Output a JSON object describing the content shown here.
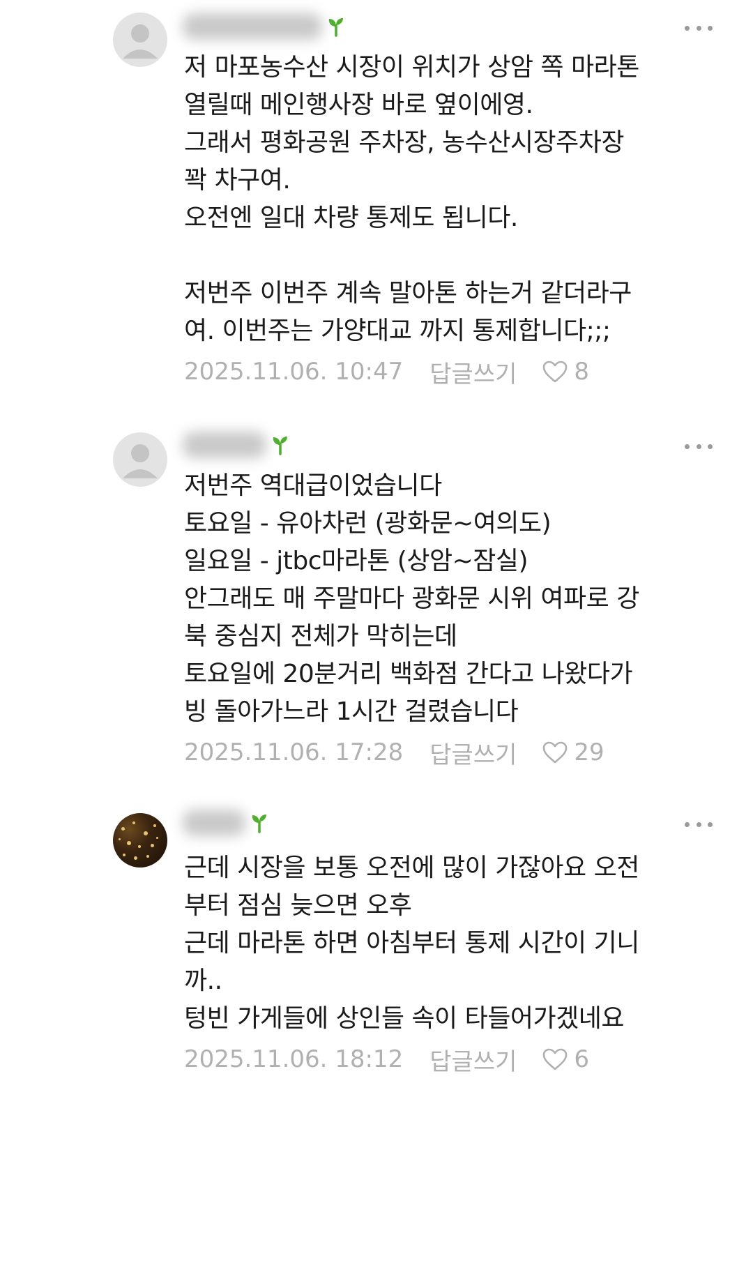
{
  "comments": [
    {
      "avatar": "default-avatar-icon",
      "nickname": "blurred-user-1",
      "body": "저 마포농수산 시장이 위치가 상암 쪽 마라톤\n열릴때 메인행사장 바로 옆이에영.\n그래서 평화공원 주차장, 농수산시장주차장\n꽉 차구여.\n오전엔 일대 차량 통제도 됩니다.\n\n저번주 이번주 계속 말아톤 하는거 같더라구\n여. 이번주는 가양대교 까지 통제합니다;;;",
      "date": "2025.11.06. 10:47",
      "reply_label": "답글쓰기",
      "likes": "8"
    },
    {
      "avatar": "default-avatar-icon",
      "nickname": "blurred-user-2",
      "body": "저번주 역대급이었습니다\n토요일 - 유아차런 (광화문~여의도)\n일요일 - jtbc마라톤 (상암~잠실)\n안그래도 매 주말마다 광화문 시위 여파로 강\n북 중심지 전체가 막히는데\n토요일에 20분거리 백화점 간다고 나왔다가\n빙 돌아가느라 1시간 걸렸습니다",
      "date": "2025.11.06. 17:28",
      "reply_label": "답글쓰기",
      "likes": "29"
    },
    {
      "avatar": "photo-avatar",
      "nickname": "blurred-user-3",
      "body": "근데 시장을 보통 오전에 많이 가잖아요 오전\n부터 점심 늦으면 오후\n근데 마라톤 하면 아침부터 통제 시간이 기니\n까..\n텅빈 가게들에 상인들 속이 타들어가겠네요",
      "date": "2025.11.06. 18:12",
      "reply_label": "답글쓰기",
      "likes": "6"
    }
  ],
  "colors": {
    "text": "#1a1a1a",
    "meta": "#b0b0b0",
    "sprout": "#4caf2a",
    "more": "#9a9a9a"
  }
}
